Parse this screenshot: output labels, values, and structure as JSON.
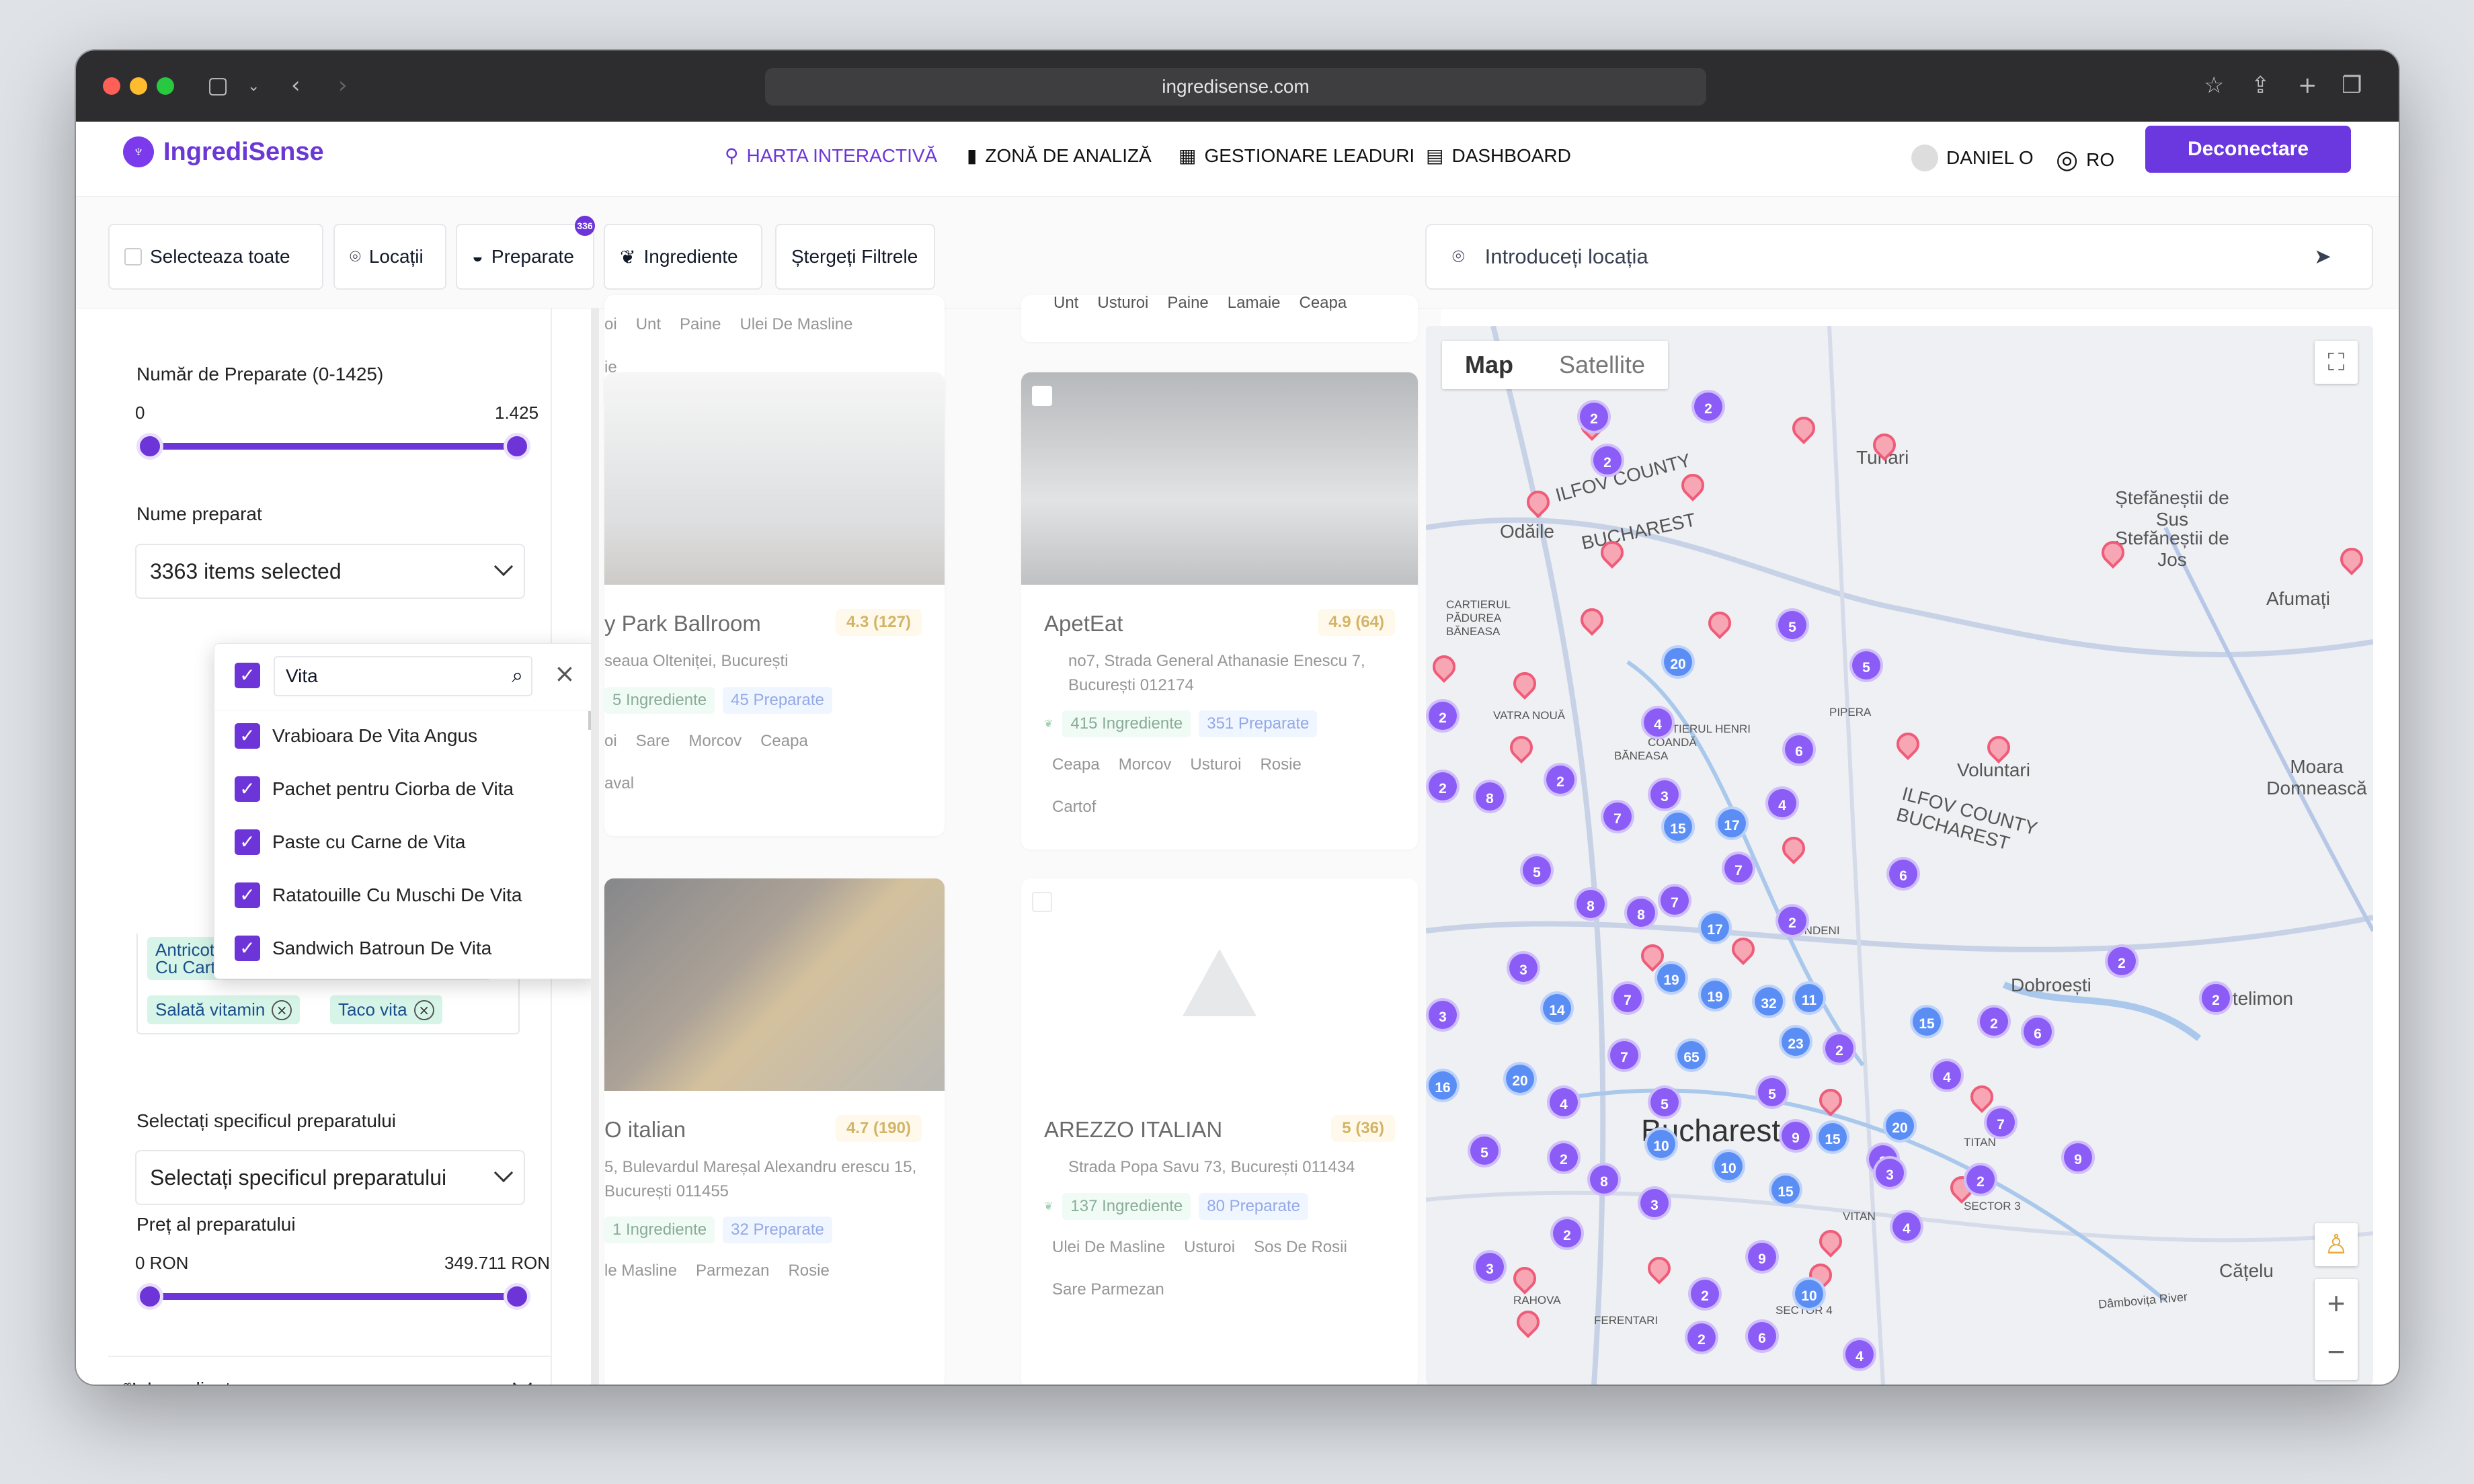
{
  "browser": {
    "url": "ingredisense.com"
  },
  "app": {
    "name": "IngrediSense",
    "nav": [
      {
        "label": "HARTA INTERACTIVĂ"
      },
      {
        "label": "ZONĂ DE ANALIZĂ"
      },
      {
        "label": "GESTIONARE LEADURI"
      },
      {
        "label": "DASHBOARD"
      }
    ],
    "user": "DANIEL O",
    "lang": "RO",
    "logout": "Deconectare"
  },
  "filters": {
    "select_all": "Selecteaza toate",
    "locations": "Locații",
    "dishes": "Preparate",
    "dishes_badge": "336",
    "ingredients": "Ingrediente",
    "clear": "Ștergeți Filtrele",
    "location_placeholder": "Introduceți locația"
  },
  "sidebar": {
    "dish_count_label": "Număr de Preparate (0-1425)",
    "dish_min": "0",
    "dish_max": "1.425",
    "dish_name_label": "Nume preparat",
    "dish_selected": "3363 items selected",
    "search_value": "Vita",
    "options": [
      "Vrabioara De Vita Angus",
      "Pachet pentru Ciorba de Vita",
      "Paste cu Carne de Vita",
      "Ratatouille Cu Muschi De Vita",
      "Sandwich Batroun De Vita"
    ],
    "chips": [
      "Antricot De Vita Argentina La Gratar Cu Cartofi Ciobanesti",
      "Salată vitamin",
      "Taco vita"
    ],
    "spec_label": "Selectați specificul preparatului",
    "spec_placeholder": "Selectați specificul preparatului",
    "price_label": "Preț al preparatului",
    "price_min": "0 RON",
    "price_max": "349.711 RON",
    "ingredients_section": "Ingrediente"
  },
  "cards": [
    {
      "name": "y Park Ballroom",
      "rating": "4.3 (127)",
      "address": "seaua Olteniței, București",
      "ingredients": "5 Ingrediente",
      "dishes": "45 Preparate",
      "items": [
        "oi",
        "Sare",
        "Morcov",
        "Ceapa"
      ],
      "extra": "aval"
    },
    {
      "name": "ApetEat",
      "rating": "4.9 (64)",
      "address": "no7, Strada General Athanasie Enescu 7, București 012174",
      "ingredients": "415 Ingrediente",
      "dishes": "351 Preparate",
      "items": [
        "Ceapa",
        "Morcov",
        "Usturoi",
        "Rosie"
      ],
      "extra": "Cartof"
    },
    {
      "name": "O italian",
      "rating": "4.7 (190)",
      "address": "5, Bulevardul Mareșal Alexandru erescu 15, București 011455",
      "ingredients": "1 Ingrediente",
      "dishes": "32 Preparate",
      "items": [
        "le Masline",
        "Parmezan",
        "Rosie"
      ]
    },
    {
      "name": "AREZZO ITALIAN",
      "rating": "5 (36)",
      "address": "Strada Popa Savu 73, București 011434",
      "ingredients": "137 Ingrediente",
      "dishes": "80 Preparate",
      "items": [
        "Ulei De Masline",
        "Usturoi",
        "Sos De Rosii"
      ],
      "extra": "Sare    Parmezan"
    }
  ],
  "top_tags": {
    "left": [
      "oi",
      "Unt",
      "Paine",
      "Ulei De Masline"
    ],
    "left2": "ie",
    "right": [
      "Unt",
      "Usturoi",
      "Paine",
      "Lamaie",
      "Ceapa"
    ]
  },
  "map": {
    "tab_map": "Map",
    "tab_satellite": "Satellite",
    "labels": [
      "Odăile",
      "ILFOV COUNTY",
      "BUCHAREST",
      "Tunari",
      "Ștefăneștii de Sus",
      "Ștefăneștii de Jos",
      "Afumați",
      "CARTIERUL PĂDUREA BĂNEASA",
      "VATRA NOUĂ",
      "CARTIERUL HENRI COANDĂ",
      "PIPERA",
      "BĂNEASA",
      "Voluntari",
      "ILFOV COUNTY BUCHAREST",
      "Moara Domnească",
      "FUNDENI",
      "Dobroești",
      "Pantelimon",
      "Bucharest",
      "TITAN",
      "VITAN",
      "Cățelu",
      "RAHOVA",
      "FERENTARI",
      "SECTOR 3",
      "SECTOR 4",
      "Dâmbovița River"
    ],
    "clusters": [
      "2",
      "2",
      "2",
      "5",
      "5",
      "20",
      "4",
      "6",
      "2",
      "3",
      "7",
      "15",
      "17",
      "4",
      "7",
      "6",
      "5",
      "8",
      "8",
      "7",
      "2",
      "17",
      "2",
      "19",
      "19",
      "32",
      "11",
      "14",
      "3",
      "7",
      "23",
      "2",
      "15",
      "2",
      "6",
      "2",
      "4",
      "5",
      "65",
      "7",
      "5",
      "16",
      "20",
      "4",
      "3",
      "10",
      "5",
      "15",
      "9",
      "20",
      "7",
      "3",
      "2",
      "10",
      "15",
      "8",
      "2",
      "9",
      "3",
      "2",
      "9",
      "4",
      "2",
      "6",
      "10",
      "4",
      "3",
      "2",
      "2",
      "2",
      "8",
      "3"
    ]
  }
}
